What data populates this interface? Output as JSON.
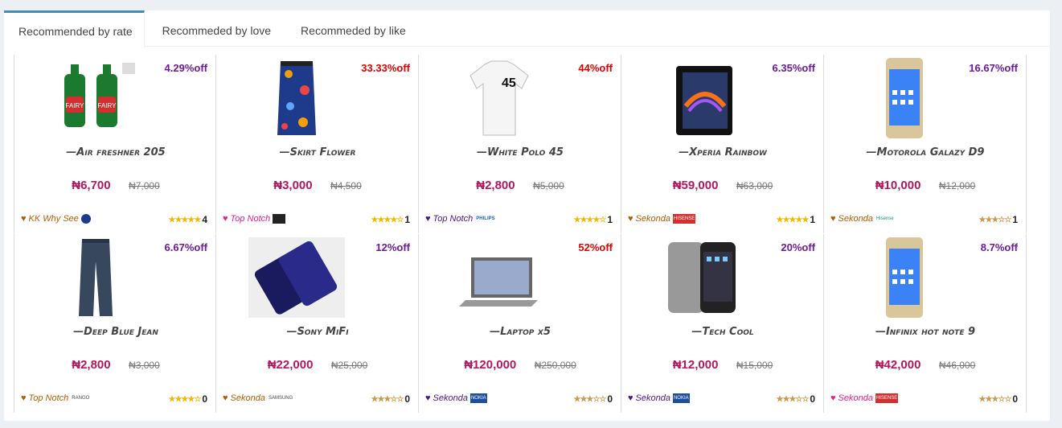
{
  "tabs": [
    "Recommended by rate",
    "Recommeded by love",
    "Recommeded by like"
  ],
  "products": [
    {
      "name": "—Air freshner 205",
      "discount": "4.29%off",
      "disc_color": "#6a1b9a",
      "price": "₦6,700",
      "old": "₦7,000",
      "vendor": "KK Why See",
      "vendor_color": "#b35c00",
      "logo": "",
      "logo_type": "circle",
      "stars": "★★★★★",
      "star_color": "#f5b800",
      "count": "4",
      "image": "fairy-bottles-icon"
    },
    {
      "name": "—Skirt Flower",
      "discount": "33.33%off",
      "disc_color": "#e00000",
      "price": "₦3,000",
      "old": "₦4,500",
      "vendor": "Top Notch",
      "vendor_color": "#e91e8c",
      "logo": "",
      "logo_type": "dark",
      "stars": "★★★★☆",
      "star_color": "#f5b800",
      "count": "1",
      "image": "skirt-icon"
    },
    {
      "name": "—White Polo 45",
      "discount": "44%off",
      "disc_color": "#e00000",
      "price": "₦2,800",
      "old": "₦5,000",
      "vendor": "Top Notch",
      "vendor_color": "#4a148c",
      "logo": "PHILIPS",
      "logo_type": "text-blue",
      "stars": "★★★★☆",
      "star_color": "#f5b800",
      "count": "1",
      "image": "polo-shirt-icon"
    },
    {
      "name": "—Xperia Rainbow",
      "discount": "6.35%off",
      "disc_color": "#6a1b9a",
      "price": "₦59,000",
      "old": "₦63,000",
      "vendor": "Sekonda",
      "vendor_color": "#b35c00",
      "logo": "HISENSE",
      "logo_type": "red",
      "stars": "★★★★★",
      "star_color": "#f5b800",
      "count": "1",
      "image": "phone-dark-icon"
    },
    {
      "name": "—Motorola Galazy D9",
      "discount": "16.67%off",
      "disc_color": "#6a1b9a",
      "price": "₦10,000",
      "old": "₦12,000",
      "vendor": "Sekonda",
      "vendor_color": "#b35c00",
      "logo": "Hisense",
      "logo_type": "text-teal",
      "stars": "★★★☆☆",
      "star_color": "#c89a4b",
      "count": "1",
      "image": "phone-gold-icon"
    },
    {
      "name": "—Deep Blue Jean",
      "discount": "6.67%off",
      "disc_color": "#6a1b9a",
      "price": "₦2,800",
      "old": "₦3,000",
      "vendor": "Top Notch",
      "vendor_color": "#b35c00",
      "logo": "RANGO",
      "logo_type": "text-gray",
      "stars": "★★★★☆",
      "star_color": "#f5b800",
      "count": "0",
      "image": "jeans-icon"
    },
    {
      "name": "—Sony MiFi",
      "discount": "12%off",
      "disc_color": "#6a1b9a",
      "price": "₦22,000",
      "old": "₦25,000",
      "vendor": "Sekonda",
      "vendor_color": "#b35c00",
      "logo": "SAMSUNG",
      "logo_type": "text-gray",
      "stars": "★★★☆☆",
      "star_color": "#c89a4b",
      "count": "0",
      "image": "phone-blue-icon"
    },
    {
      "name": "—Laptop x5",
      "discount": "52%off",
      "disc_color": "#e00000",
      "price": "₦120,000",
      "old": "₦250,000",
      "vendor": "Sekonda",
      "vendor_color": "#4a148c",
      "logo": "NOKIA",
      "logo_type": "blue",
      "stars": "★★★☆☆",
      "star_color": "#c89a4b",
      "count": "0",
      "image": "laptop-icon"
    },
    {
      "name": "—Tech Cool",
      "discount": "20%off",
      "disc_color": "#6a1b9a",
      "price": "₦12,000",
      "old": "₦15,000",
      "vendor": "Sekonda",
      "vendor_color": "#4a148c",
      "logo": "NOKIA",
      "logo_type": "blue",
      "stars": "★★★☆☆",
      "star_color": "#c89a4b",
      "count": "0",
      "image": "iphone-icon"
    },
    {
      "name": "—Infinix hot note 9",
      "discount": "8.7%off",
      "disc_color": "#6a1b9a",
      "price": "₦42,000",
      "old": "₦46,000",
      "vendor": "Sekonda",
      "vendor_color": "#e91e8c",
      "logo": "HISENSE",
      "logo_type": "red",
      "stars": "★★★☆☆",
      "star_color": "#c89a4b",
      "count": "0",
      "image": "phone-gold-icon"
    }
  ]
}
